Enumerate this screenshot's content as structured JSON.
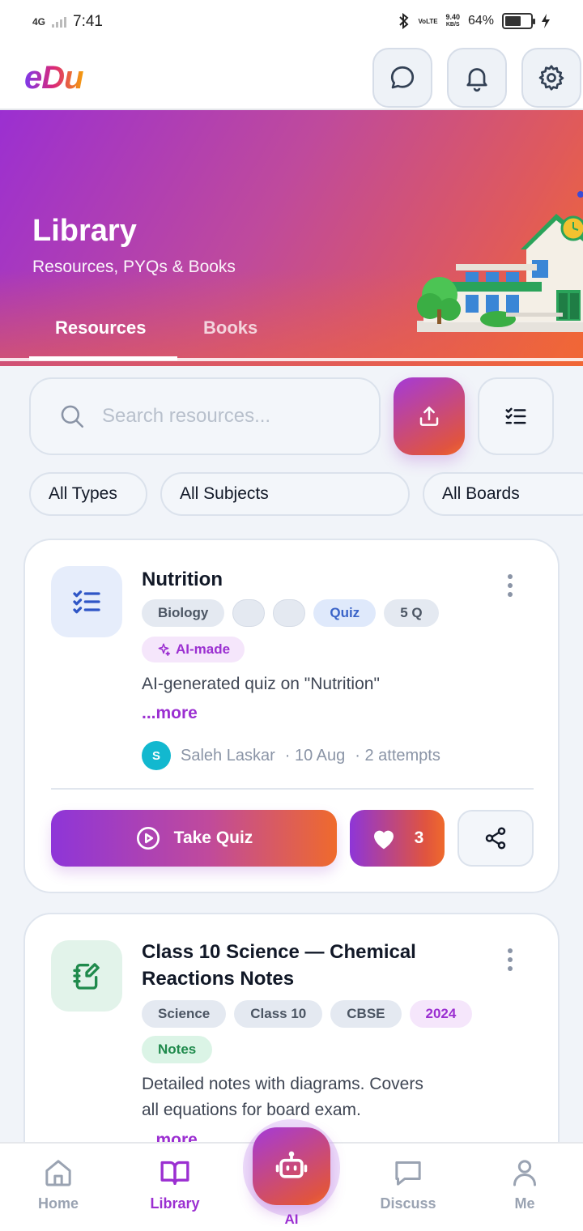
{
  "status_bar": {
    "network": "4G",
    "time": "7:41",
    "volte": "VoLTE",
    "speed_value": "9.40",
    "speed_unit": "KB/S",
    "battery": "64%",
    "battery_level": 0.64
  },
  "app": {
    "logo_text": "eDu",
    "colors": {
      "brand_purple": "#9b2fd1",
      "brand_orange": "#f26a2e",
      "background": "#f1f4f9"
    }
  },
  "hero": {
    "title": "Library",
    "subtitle": "Resources, PYQs & Books",
    "tabs": [
      {
        "label": "Resources",
        "active": true
      },
      {
        "label": "Books",
        "active": false
      }
    ]
  },
  "search": {
    "placeholder": "Search resources..."
  },
  "filters": [
    {
      "label": "All Types"
    },
    {
      "label": "All Subjects"
    },
    {
      "label": "All Boards"
    }
  ],
  "cards": [
    {
      "type_icon": "checklist-icon",
      "title": "Nutrition",
      "chips": [
        "Biology",
        "",
        "",
        "Quiz",
        "5 Q"
      ],
      "ai_badge": "AI-made",
      "description": "AI-generated quiz on \"Nutrition\"",
      "more": "...more",
      "author_initial": "S",
      "author": "Saleh Laskar",
      "date": "· 10 Aug",
      "attempts": "· 2 attempts",
      "primary_action": "Take Quiz",
      "likes": "3"
    },
    {
      "type_icon": "notes-icon",
      "title_line1": "Class 10 Science — Chemical",
      "title_line2": "Reactions Notes",
      "chips": [
        "Science",
        "Class 10",
        "CBSE",
        "2024",
        "Notes"
      ],
      "description_line1": "Detailed notes with diagrams. Covers",
      "description_line2": "all equations for board exam.",
      "more": "...more"
    }
  ],
  "bottom_nav": [
    {
      "label": "Home",
      "icon": "home-icon",
      "active": false
    },
    {
      "label": "Library",
      "icon": "book-icon",
      "active": true
    },
    {
      "label": "AI",
      "icon": "robot-icon",
      "active": false
    },
    {
      "label": "Discuss",
      "icon": "chat-icon",
      "active": false
    },
    {
      "label": "Me",
      "icon": "person-icon",
      "active": false
    }
  ]
}
